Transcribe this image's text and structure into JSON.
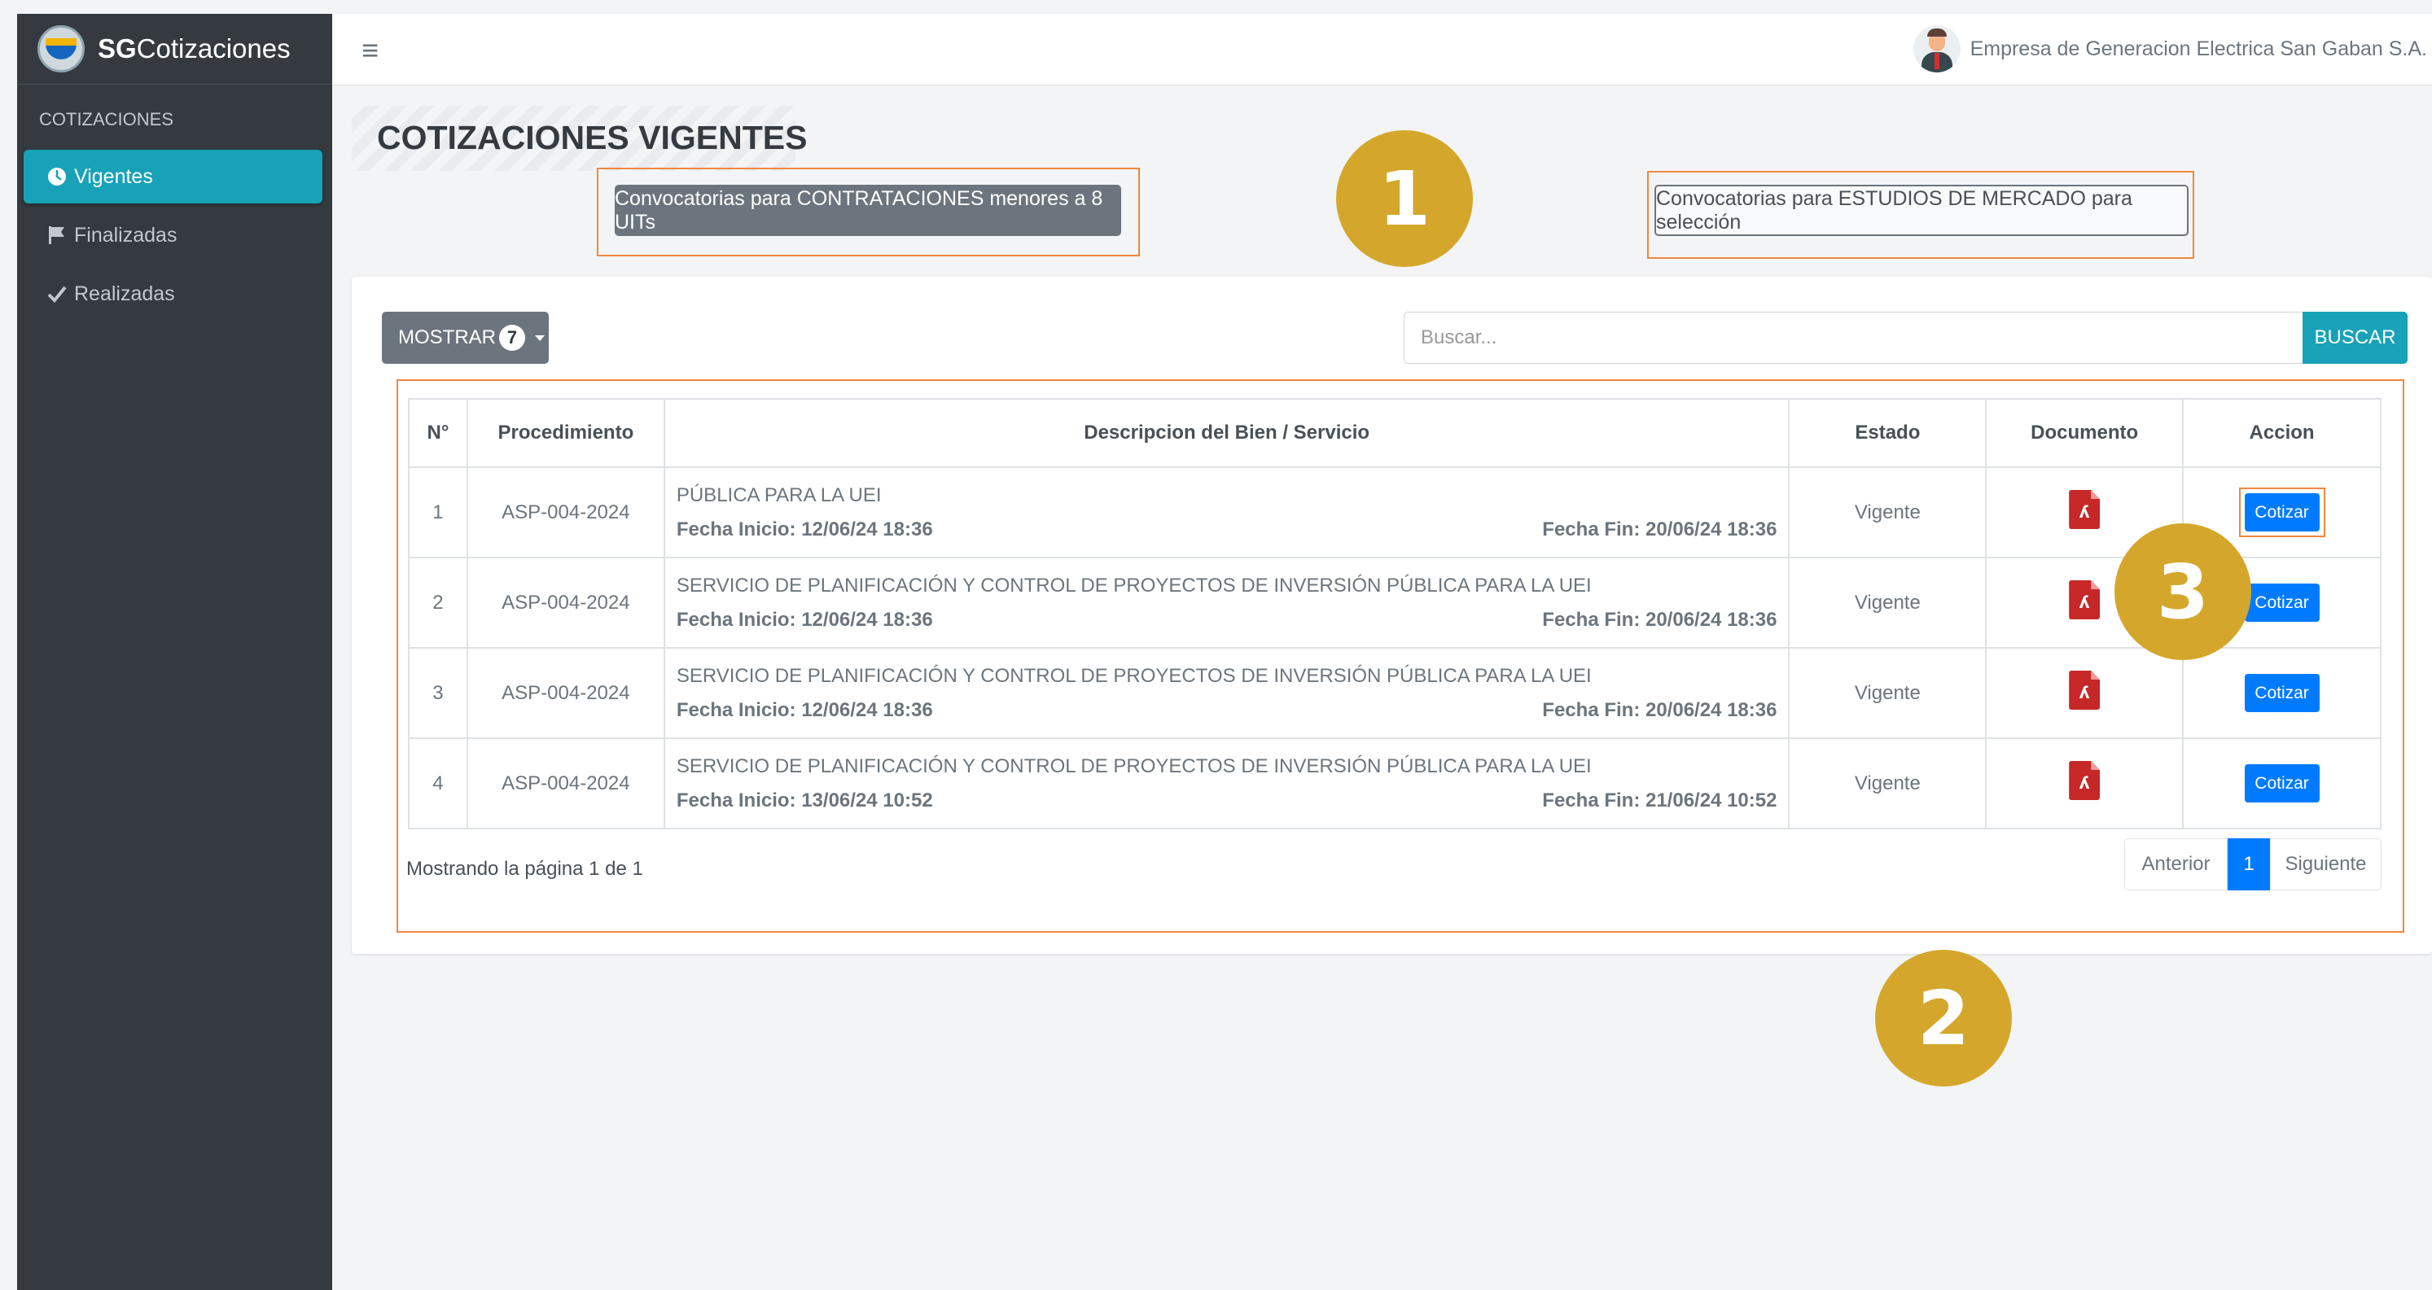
{
  "brand": {
    "bold": "SG",
    "rest": "Cotizaciones"
  },
  "sidebar": {
    "header": "COTIZACIONES",
    "items": [
      {
        "label": "Vigentes",
        "icon": "clock-icon",
        "active": true
      },
      {
        "label": "Finalizadas",
        "icon": "flag-icon",
        "active": false
      },
      {
        "label": "Realizadas",
        "icon": "check-icon",
        "active": false
      }
    ]
  },
  "topbar": {
    "menu_icon": "≡",
    "user_name": "Empresa de Generacion Electrica San Gaban S.A."
  },
  "page": {
    "title": "COTIZACIONES VIGENTES",
    "btn_contrataciones": "Convocatorias para CONTRATACIONES menores a 8 UITs",
    "btn_estudios": "Convocatorias para ESTUDIOS DE MERCADO para selección"
  },
  "badges": [
    "1",
    "2",
    "3"
  ],
  "toolbar": {
    "mostrar_label": "MOSTRAR",
    "mostrar_count": "7",
    "search_placeholder": "Buscar...",
    "buscar_label": "BUSCAR"
  },
  "table": {
    "headers": [
      "N°",
      "Procedimiento",
      "Descripcion del Bien / Servicio",
      "Estado",
      "Documento",
      "Accion"
    ],
    "rows": [
      {
        "n": "1",
        "proc": "ASP-004-2024",
        "desc": "PÚBLICA PARA LA UEI",
        "inicio": "Fecha Inicio: 12/06/24 18:36",
        "fin": "Fecha Fin: 20/06/24 18:36",
        "estado": "Vigente",
        "accion": "Cotizar"
      },
      {
        "n": "2",
        "proc": "ASP-004-2024",
        "desc": "SERVICIO DE PLANIFICACIÓN Y CONTROL DE PROYECTOS DE INVERSIÓN PÚBLICA PARA LA UEI",
        "inicio": "Fecha Inicio: 12/06/24 18:36",
        "fin": "Fecha Fin: 20/06/24 18:36",
        "estado": "Vigente",
        "accion": "Cotizar"
      },
      {
        "n": "3",
        "proc": "ASP-004-2024",
        "desc": "SERVICIO DE PLANIFICACIÓN Y CONTROL DE PROYECTOS DE INVERSIÓN PÚBLICA PARA LA UEI",
        "inicio": "Fecha Inicio: 12/06/24 18:36",
        "fin": "Fecha Fin: 20/06/24 18:36",
        "estado": "Vigente",
        "accion": "Cotizar"
      },
      {
        "n": "4",
        "proc": "ASP-004-2024",
        "desc": "SERVICIO DE PLANIFICACIÓN Y CONTROL DE PROYECTOS DE INVERSIÓN PÚBLICA PARA LA UEI",
        "inicio": "Fecha Inicio: 13/06/24 10:52",
        "fin": "Fecha Fin: 21/06/24 10:52",
        "estado": "Vigente",
        "accion": "Cotizar"
      }
    ]
  },
  "pagination": {
    "info": "Mostrando la página 1 de 1",
    "prev": "Anterior",
    "current": "1",
    "next": "Siguiente"
  },
  "colors": {
    "sidebar": "#343a40",
    "active": "#17a2b8",
    "primary": "#007bff",
    "badge": "#d4a72c",
    "highlight": "#f0883e",
    "pdf": "#c62828"
  }
}
